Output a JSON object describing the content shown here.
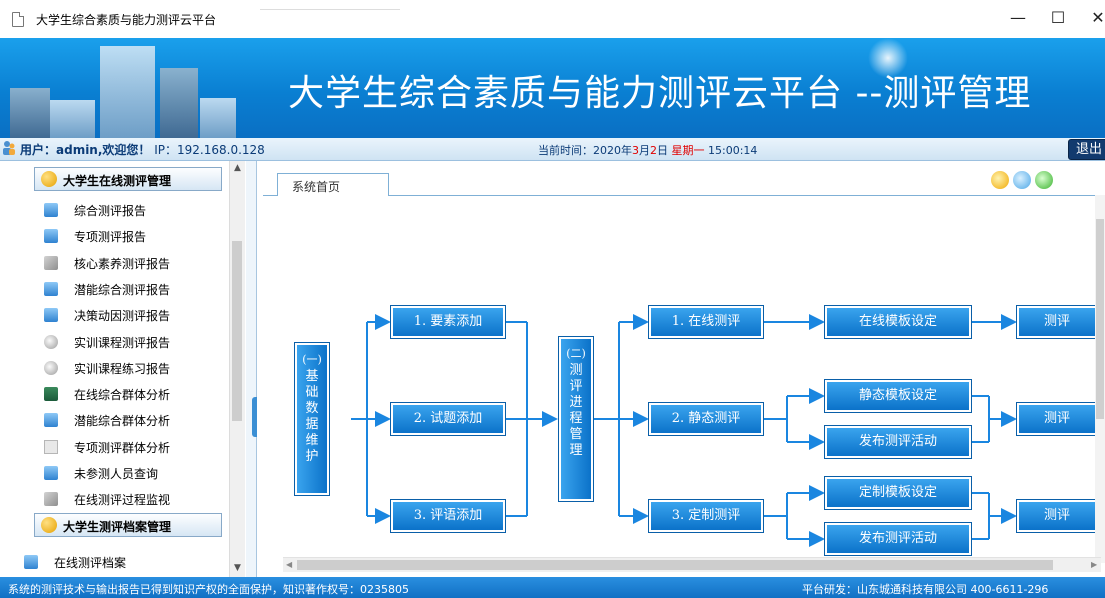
{
  "window": {
    "title": "大学生综合素质与能力测评云平台",
    "minimize": "—",
    "maximize": "☐",
    "close": "✕"
  },
  "banner": {
    "title": "大学生综合素质与能力测评云平台 --测评管理"
  },
  "infobar": {
    "user_label": "用户：admin,欢迎您！",
    "ip": "IP：192.168.0.128",
    "time_prefix": "当前时间：2020年",
    "time_month": "3",
    "time_month_unit": "月",
    "time_day": "2",
    "time_day_unit": "日 ",
    "time_weekday": "星期一",
    "time_clock": " 15:00:14",
    "logout": "退出"
  },
  "sidebar": {
    "group1": "大学生在线测评管理",
    "items": [
      {
        "label": "综合测评报告",
        "icon": "report-icon"
      },
      {
        "label": "专项测评报告",
        "icon": "report-icon"
      },
      {
        "label": "核心素养测评报告",
        "icon": "wrench-icon"
      },
      {
        "label": "潜能综合测评报告",
        "icon": "report-icon"
      },
      {
        "label": "决策动因测评报告",
        "icon": "report-icon"
      },
      {
        "label": "实训课程测评报告",
        "icon": "gear-icon"
      },
      {
        "label": "实训课程练习报告",
        "icon": "gear-icon"
      },
      {
        "label": "在线综合群体分析",
        "icon": "book-icon"
      },
      {
        "label": "潜能综合群体分析",
        "icon": "report-icon"
      },
      {
        "label": "专项测评群体分析",
        "icon": "sheet-icon"
      },
      {
        "label": "未参测人员查询",
        "icon": "report-icon"
      },
      {
        "label": "在线测评过程监视",
        "icon": "wrench-icon"
      }
    ],
    "group2": "大学生测评档案管理",
    "items2": [
      {
        "label": "在线测评档案",
        "icon": "report-icon"
      }
    ]
  },
  "main": {
    "tab_home": "系统首页"
  },
  "flow": {
    "left_block": {
      "head": "(一)",
      "chars": [
        "基",
        "础",
        "数",
        "据",
        "维",
        "护"
      ]
    },
    "mid_block": {
      "head": "(二)",
      "chars": [
        "测",
        "评",
        "进",
        "程",
        "管",
        "理"
      ]
    },
    "col1": [
      "1. 要素添加",
      "2. 试题添加",
      "3. 评语添加"
    ],
    "col2": [
      "1. 在线测评",
      "2. 静态测评",
      "3. 定制测评"
    ],
    "col3": [
      "在线模板设定",
      "静态模板设定",
      "发布测评活动",
      "定制模板设定",
      "发布测评活动"
    ],
    "col4": [
      "测评",
      "测评",
      "测评"
    ]
  },
  "footer": {
    "left": "系统的测评技术与输出报告已得到知识产权的全面保护，知识著作权号：0235805",
    "right": "平台研发：山东城通科技有限公司 400-6611-296"
  }
}
